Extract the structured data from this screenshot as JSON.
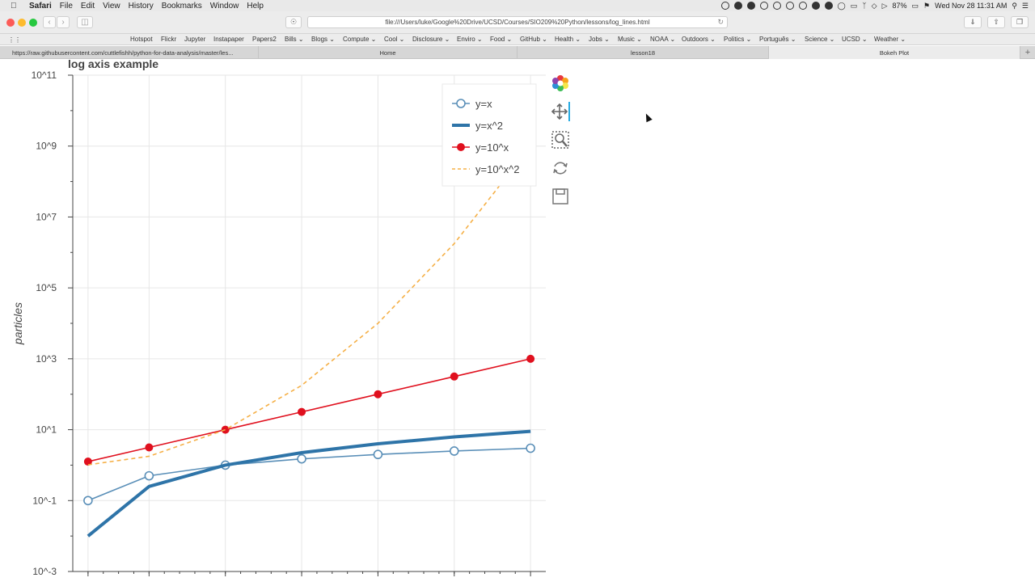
{
  "menubar": {
    "app": "Safari",
    "items": [
      "File",
      "Edit",
      "View",
      "History",
      "Bookmarks",
      "Window",
      "Help"
    ],
    "battery": "87%",
    "clock": "Wed Nov 28  11:31 AM"
  },
  "toolbar": {
    "url": "file:///Users/luke/Google%20Drive/UCSD/Courses/SIO209%20Python/lessons/log_lines.html"
  },
  "bookmarks": [
    "Hotspot",
    "Flickr",
    "Jupyter",
    "Instapaper",
    "Papers2",
    "Bills ⌄",
    "Blogs ⌄",
    "Compute ⌄",
    "Cool ⌄",
    "Disclosure ⌄",
    "Enviro ⌄",
    "Food ⌄",
    "GitHub ⌄",
    "Health ⌄",
    "Jobs ⌄",
    "Music ⌄",
    "NOAA ⌄",
    "Outdoors ⌄",
    "Politics ⌄",
    "Português ⌄",
    "Science ⌄",
    "UCSD ⌄",
    "Weather ⌄"
  ],
  "tabs": [
    {
      "label": "https://raw.githubusercontent.com/cuttlefishh/python-for-data-analysis/master/les...",
      "active": false
    },
    {
      "label": "Home",
      "active": false
    },
    {
      "label": "lesson18",
      "active": false
    },
    {
      "label": "Bokeh Plot",
      "active": true
    }
  ],
  "chart_data": {
    "type": "line",
    "title": "log axis example",
    "ylabel": "particles",
    "xlabel": "",
    "yscale": "log",
    "ylim": [
      0.001,
      100000000000
    ],
    "xlim": [
      0.0,
      3.1
    ],
    "ytick_labels": [
      "10^-3",
      "10^-1",
      "10^1",
      "10^3",
      "10^5",
      "10^7",
      "10^9",
      "10^11"
    ],
    "grid": true,
    "legend_position": "top-right",
    "x": [
      0.1,
      0.5,
      1.0,
      1.5,
      2.0,
      2.5,
      3.0
    ],
    "series": [
      {
        "name": "y=x",
        "style": "line-open-circles",
        "color": "#5a8fb8",
        "values": [
          0.1,
          0.5,
          1.0,
          1.5,
          2.0,
          2.5,
          3.0
        ]
      },
      {
        "name": "y=x^2",
        "style": "thick-line",
        "color": "#2e74a8",
        "values": [
          0.01,
          0.25,
          1.0,
          2.25,
          4.0,
          6.25,
          9.0
        ]
      },
      {
        "name": "y=10^x",
        "style": "line-filled-circles",
        "color": "#e0101e",
        "values": [
          1.2589,
          3.1623,
          10,
          31.623,
          100,
          316.23,
          1000
        ]
      },
      {
        "name": "y=10^x^2",
        "style": "dashed",
        "color": "#f5b047",
        "values": [
          1.0233,
          1.7783,
          10,
          177.83,
          10000,
          1778279.4,
          1000000000
        ]
      }
    ]
  },
  "colors": {
    "accent": "#26aae1",
    "grid": "#e6e6e6"
  },
  "icons": [
    "bokeh-logo-icon",
    "pan-icon",
    "box-zoom-icon",
    "reset-icon",
    "save-icon"
  ]
}
